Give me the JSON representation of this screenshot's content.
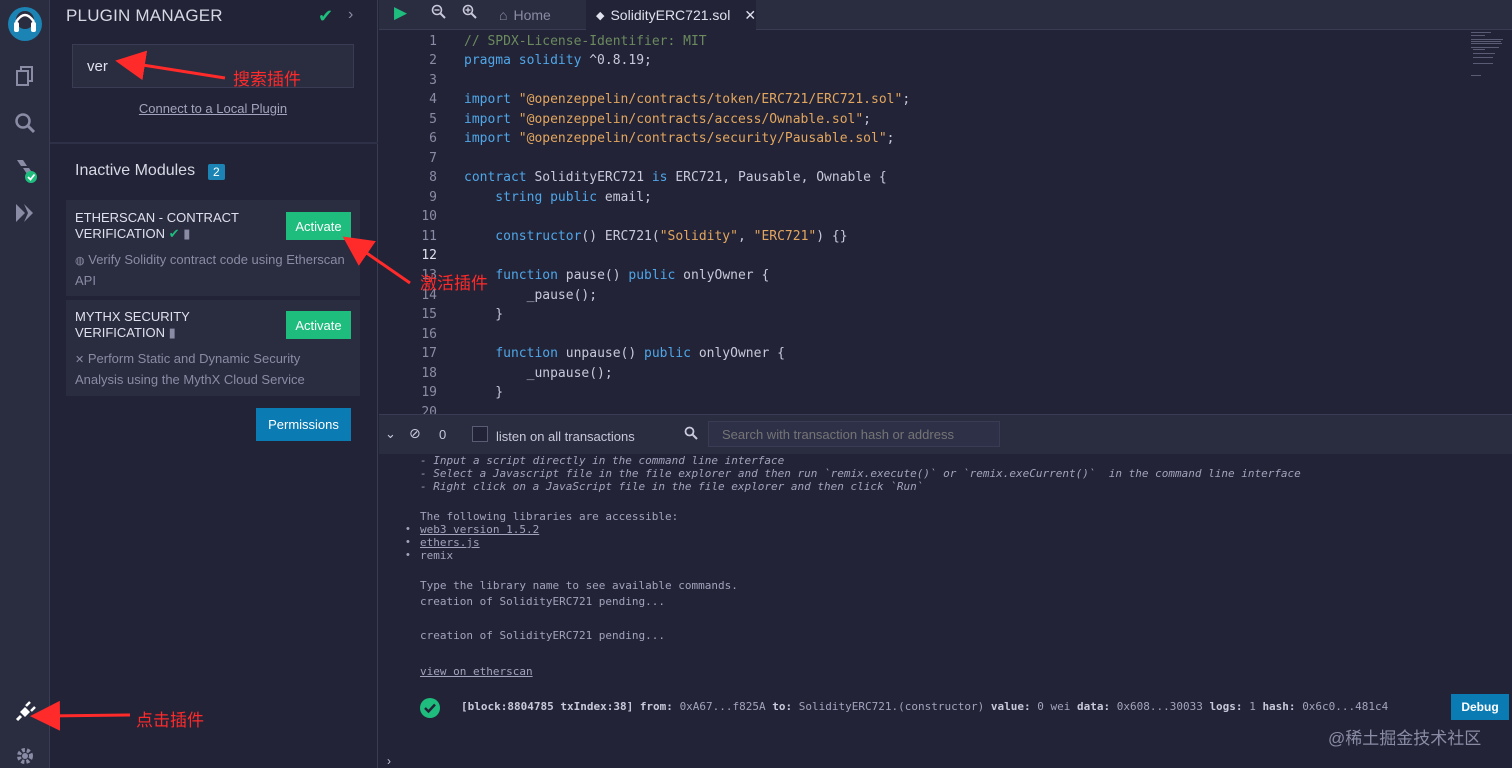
{
  "sidebar_icons": [
    "remix-logo-icon",
    "file-explorer-icon",
    "search-icon",
    "compiler-icon",
    "deploy-icon"
  ],
  "plugin_manager": {
    "title": "PLUGIN MANAGER",
    "search_value": "ver",
    "connect_link": "Connect to a Local Plugin",
    "inactive_title": "Inactive Modules",
    "inactive_count": "2",
    "modules": [
      {
        "name": "ETHERSCAN - CONTRACT VERIFICATION",
        "button": "Activate",
        "description": "Verify Solidity contract code using Etherscan API"
      },
      {
        "name": "MYTHX SECURITY VERIFICATION",
        "button": "Activate",
        "description": "Perform Static and Dynamic Security Analysis using the MythX Cloud Service"
      }
    ],
    "permissions_button": "Permissions"
  },
  "tabs": {
    "home": "Home",
    "file": "SolidityERC721.sol"
  },
  "code": {
    "line_numbers": [
      "1",
      "2",
      "3",
      "4",
      "5",
      "6",
      "7",
      "8",
      "9",
      "10",
      "11",
      "12",
      "13",
      "14",
      "15",
      "16",
      "17",
      "18",
      "19",
      "20"
    ],
    "l1": "// SPDX-License-Identifier: MIT",
    "l2a": "pragma solidity",
    "l2b": " ^0.8.19;",
    "imp": "import ",
    "l4s": "\"@openzeppelin/contracts/token/ERC721/ERC721.sol\"",
    "l5s": "\"@openzeppelin/contracts/access/Ownable.sol\"",
    "l6s": "\"@openzeppelin/contracts/security/Pausable.sol\"",
    "semi": ";",
    "l8a": "contract",
    "l8b": " SolidityERC721 ",
    "l8c": "is",
    "l8d": " ERC721, Pausable, Ownable {",
    "l9a": "    string public",
    "l9b": " email;",
    "l11a": "    constructor",
    "l11b": "() ERC721(",
    "l11s1": "\"Solidity\"",
    "l11c": ", ",
    "l11s2": "\"ERC721\"",
    "l11d": ") {}",
    "fn": "function",
    "pub": "public",
    "l13b": " pause() ",
    "l13d": " onlyOwner {",
    "l14": "        _pause();",
    "close": "    }",
    "l17b": " unpause() ",
    "l17d": " onlyOwner {",
    "l18": "        _unpause();"
  },
  "terminal": {
    "tx_count": "0",
    "listen_label": "listen on all transactions",
    "search_placeholder": "Search with transaction hash or address",
    "lines": [
      "- Input a script directly in the command line interface",
      "- Select a Javascript file in the file explorer and then run `remix.execute()` or `remix.exeCurrent()`  in the command line interface",
      "- Right click on a JavaScript file in the file explorer and then click `Run`",
      "The following libraries are accessible:",
      "web3 version 1.5.2",
      "ethers.js",
      "remix",
      "Type the library name to see available commands.",
      "creation of SolidityERC721 pending...",
      "creation of SolidityERC721 pending...",
      "view on etherscan"
    ],
    "tx": {
      "block": "[block:8804785 txIndex:38]",
      "from_label": "from:",
      "from": "0xA67...f825A",
      "to_label": "to:",
      "to": "SolidityERC721.(constructor)",
      "value_label": "value:",
      "value": "0 wei",
      "data_label": "data:",
      "data": "0x608...30033",
      "logs_label": "logs:",
      "logs": "1",
      "hash_label": "hash:",
      "hash": "0x6c0...481c4"
    },
    "debug_button": "Debug"
  },
  "annotations": {
    "search": "搜索插件",
    "activate": "激活插件",
    "click": "点击插件"
  },
  "watermark": "@稀土掘金技术社区",
  "colors": {
    "accent_green": "#1ebd7e",
    "accent_blue": "#0a7bb3",
    "annotation_red": "#ff2a2a"
  }
}
